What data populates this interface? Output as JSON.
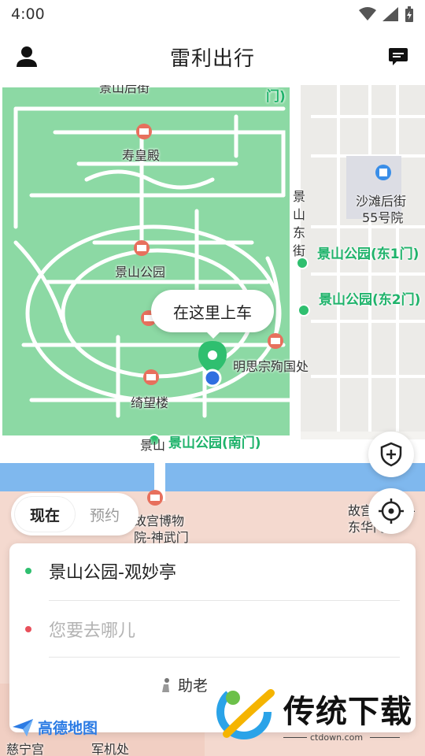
{
  "status_bar": {
    "time": "4:00"
  },
  "header": {
    "title": "雷利出行"
  },
  "map": {
    "labels": {
      "jingshan_hou": "景山后街",
      "shouhuang": "寿皇殿",
      "shatan": "沙滩后街",
      "shatan_num": "55号院",
      "jingshan_east_st": "景山东街",
      "jingshan_park": "景山公园",
      "east1": "景山公园(东1门)",
      "east2": "景山公园(东2门)",
      "chongzhen": "明思宗殉国处",
      "qiwang": "绮望楼",
      "south_gate": "景山公园(南门)",
      "jingshan_front": "景山",
      "museum": "故宫博物院-神武门",
      "museum_east": "故宫博物院-东华门",
      "cining": "慈宁宫",
      "junji": "军机处",
      "guanmiao": "观妙亭",
      "top_gate": "门)"
    }
  },
  "pickup": {
    "bubble_text": "在这里上车"
  },
  "time_tabs": {
    "now": "现在",
    "reserve": "预约"
  },
  "route": {
    "start": "景山公园-观妙亭",
    "end_placeholder": "您要去哪儿",
    "helper": "助老"
  },
  "watermark": {
    "brand": "传统下载",
    "site": "ctdown.com"
  },
  "amap": {
    "logo_text": "高德地图"
  },
  "colors": {
    "green": "#1fb36b",
    "red": "#e8505b",
    "blue": "#2b7be4"
  }
}
